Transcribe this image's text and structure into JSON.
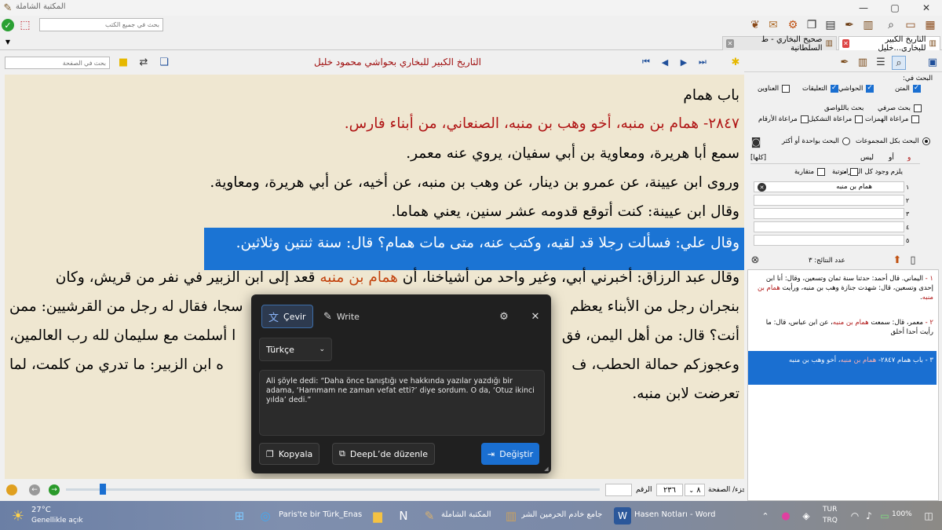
{
  "window": {
    "title": "المكتبة الشاملة"
  },
  "toolbar": {
    "search_placeholder": "بحث في جميع الكتب"
  },
  "tabs": [
    {
      "label": "التاريخ الكبير للبخاري...خليل",
      "active": true
    },
    {
      "label": "صحيح البخاري - ط السلطانية",
      "active": false
    }
  ],
  "nav": {
    "book_title": "التاريخ الكبير للبخاري بحواشي محمود خليل",
    "page_search_placeholder": "بحث في الصفحة"
  },
  "reader": {
    "l1": "باب همام",
    "l2a": "٢٨٤٧- همام بن منبه، ",
    "l2b": "أخو وهب بن منبه، الصنعاني، من أبناء فارس.",
    "l3": "سمع أبا هريرة، ومعاوية بن أبي سفيان، يروي عنه معمر.",
    "l4": "وروى ابن عيينة، عن عمرو بن دينار، عن وهب بن منبه، عن أخيه، عن أبي هريرة، ومعاوية.",
    "l5": "وقال ابن عيينة: كنت أتوقع قدومه عشر سنين، يعني هماما.",
    "l6": "وقال علي: فسألت رجلا قد لقيه، وكتب عنه، متى مات همام؟ قال: سنة ثنتين وثلاثين.",
    "l7a": "وقال عبد الرزاق: أخبرني أبي، وغير واحد من أشياخنا، أن ",
    "l7b": "همام بن منبه",
    "l7c": " قعد إلى ابن الزبير في نفر من قريش، وكان",
    "l8r": "بنجران رجل من الأبناء يعظم",
    "l8l": "سجا، فقال له رجل من القرشيين: ممن",
    "l9r": "أنت؟ قال: من أهل اليمن، فق",
    "l9l": "ا أسلمت مع سليمان لله رب العالمين،",
    "l10r": "وعجوزكم حمالة الحطب، ف",
    "l10l": "ه ابن الزبير: ما تدري من كلمت، لما",
    "l11": "تعرضت لابن منبه."
  },
  "translate": {
    "tab_translate": "Çevir",
    "tab_write": "Write",
    "language": "Türkçe",
    "text": "Ali şöyle dedi: “Daha önce tanıştığı ve hakkında yazılar yazdığı bir adama, ‘Hammam ne zaman vefat etti?’ diye sordum. O da, ‘Otuz ikinci yılda’ dedi.”",
    "copy": "Kopyala",
    "edit": "DeepL’de düzenle",
    "replace": "Değiştir"
  },
  "status": {
    "part_page_label": "الجزء/ الصفحة",
    "part": "٨",
    "page": "٢٣٦",
    "number_label": "الرقم"
  },
  "side": {
    "search_in": "البحث في:",
    "opt_text": "المتن",
    "opt_footnotes": "الحواشي",
    "opt_comments": "التعليقات",
    "opt_titles": "العناوين",
    "opt_morph": "بحث صرفي",
    "opt_affix": "بحث باللواصق",
    "opt_hamza": "مراعاة الهمزات",
    "opt_tashkeel": "مراعاة التشكيل",
    "opt_numbers": "مراعاة الأرقام",
    "opt_all_groups": "البحث بكل المجموعات",
    "opt_one_or_more": "البحث بواحدة أو أكثر",
    "g_and": "و",
    "g_or": "أو",
    "g_not": "ليس",
    "g_all": "[كلها]",
    "require_all": "يلزم وجود كل العبارات",
    "ordered": "مرتبة",
    "adjacent": "متقاربة",
    "terms": [
      "همام بن منبه",
      "",
      "",
      "",
      ""
    ],
    "term_nums": [
      "١",
      "٢",
      "٣",
      "٤",
      "٥"
    ],
    "results_count": "عدد النتائج: ٣",
    "results": [
      {
        "num": "١ - ",
        "text": "اليماني. قال أحمد: حدثنا سنة ثمان وتسعين، وقال: أنا ابن إحدى وتسعين، قال: شهدت جنازة وهب بن منبه، ورأيت ",
        "hl": "همام بن منبه",
        "tail": "."
      },
      {
        "num": "٢ - ",
        "text": "معمر، قال: سمعت ",
        "hl": "همام بن منبه",
        "tail": "، عن ابن عباس، قال: ما رأيت أحدا أخلق"
      },
      {
        "num": "٣ - ",
        "text": "باب همام ٢٨٤٧- ",
        "hl": "همام بن منبه",
        "tail": "، أخو وهب بن منبه"
      }
    ]
  },
  "taskbar": {
    "temp": "27°C",
    "weather": "Genellikle açık",
    "news": "Paris'te bir Türk_Enas",
    "app_shamela": "المكتبة الشاملة",
    "app_jami": "جامع خادم الحرمين الشر",
    "app_word": "Hasen Notları - Word",
    "lang1": "TUR",
    "lang2": "TRQ",
    "battery": "100%"
  },
  "colors": {
    "accent": "#1a6fd1",
    "highlight": "#1b74d4",
    "reader_bg": "#efe7d1",
    "red": "#b01515"
  }
}
